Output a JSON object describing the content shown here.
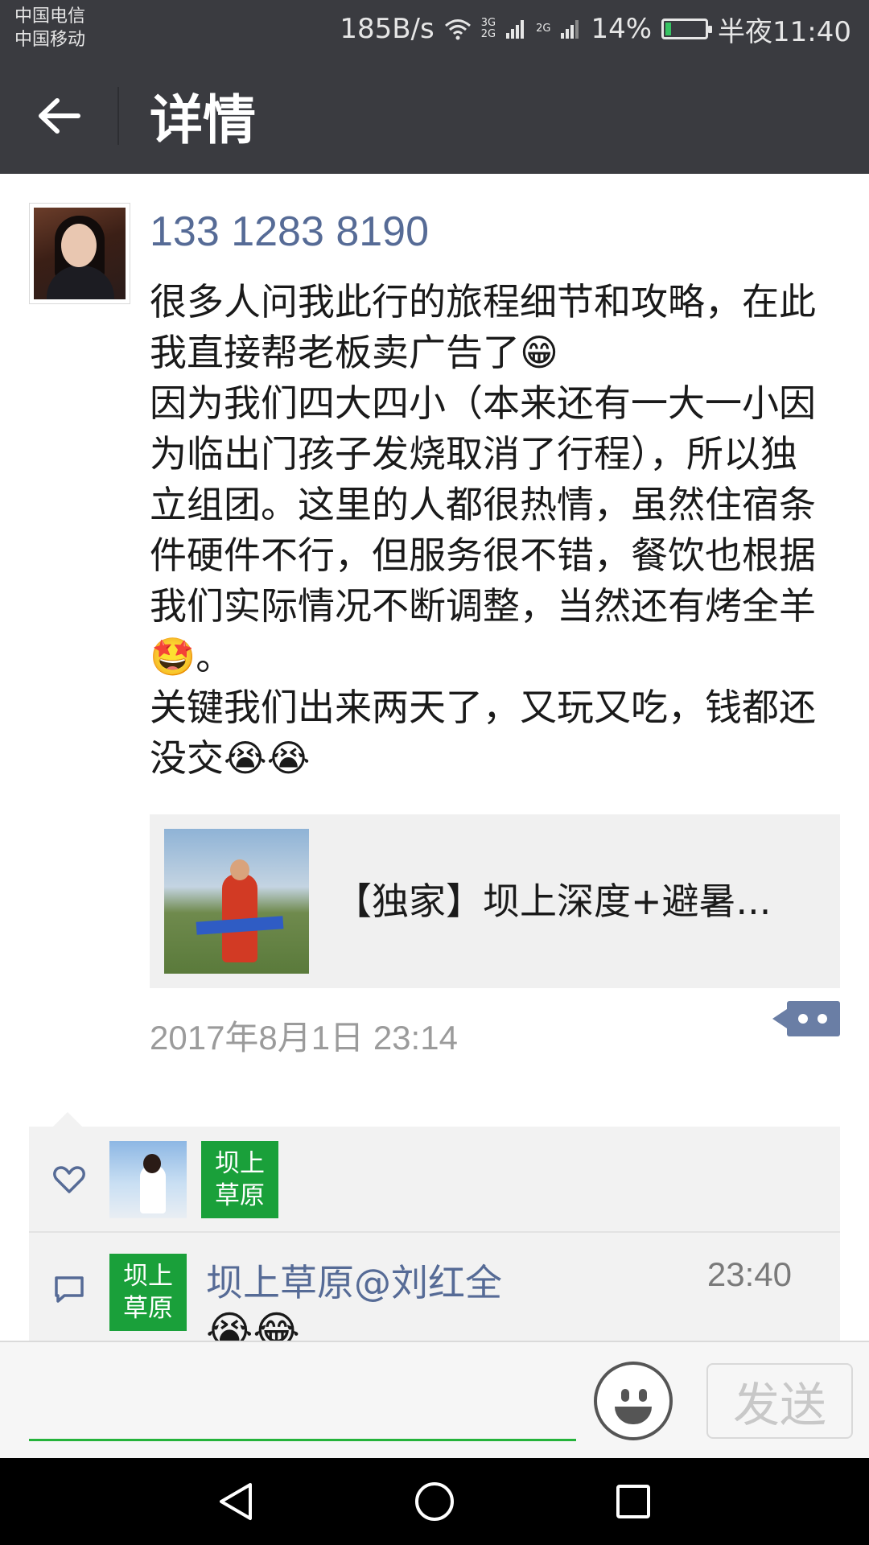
{
  "status_bar": {
    "carrier1": "中国电信",
    "carrier2": "中国移动",
    "net_speed": "185B/s",
    "net_type_top": "3G",
    "net_type_bottom": "2G",
    "net_type2": "2G",
    "battery": "14%",
    "battery_level": 0.14,
    "time": "半夜11:40"
  },
  "header": {
    "title": "详情"
  },
  "post": {
    "username": "133 1283 8190",
    "text": "很多人问我此行的旅程细节和攻略，在此我直接帮老板卖广告了😁\n因为我们四大四小（本来还有一大一小因为临出门孩子发烧取消了行程），所以独立组团。这里的人都很热情，虽然住宿条件硬件不行，但服务很不错，餐饮也根据我们实际情况不断调整，当然还有烤全羊🤩。\n关键我们出来两天了，又玩又吃，钱都还没交😭😭",
    "link_title": "【独家】坝上深度+避暑...",
    "timestamp": "2017年8月1日 23:14"
  },
  "likes": {
    "avatar2_text": "坝上草原"
  },
  "comments": [
    {
      "avatar_text": "坝上草原",
      "name": "坝上草原@刘红全",
      "time": "23:40",
      "text": "😭😂"
    }
  ],
  "input": {
    "placeholder": "",
    "send_label": "发送"
  },
  "colors": {
    "bar_bg": "#3a3b40",
    "link_blue": "#566b96",
    "green_avatar": "#1aa03a",
    "input_underline": "#25b33b"
  }
}
